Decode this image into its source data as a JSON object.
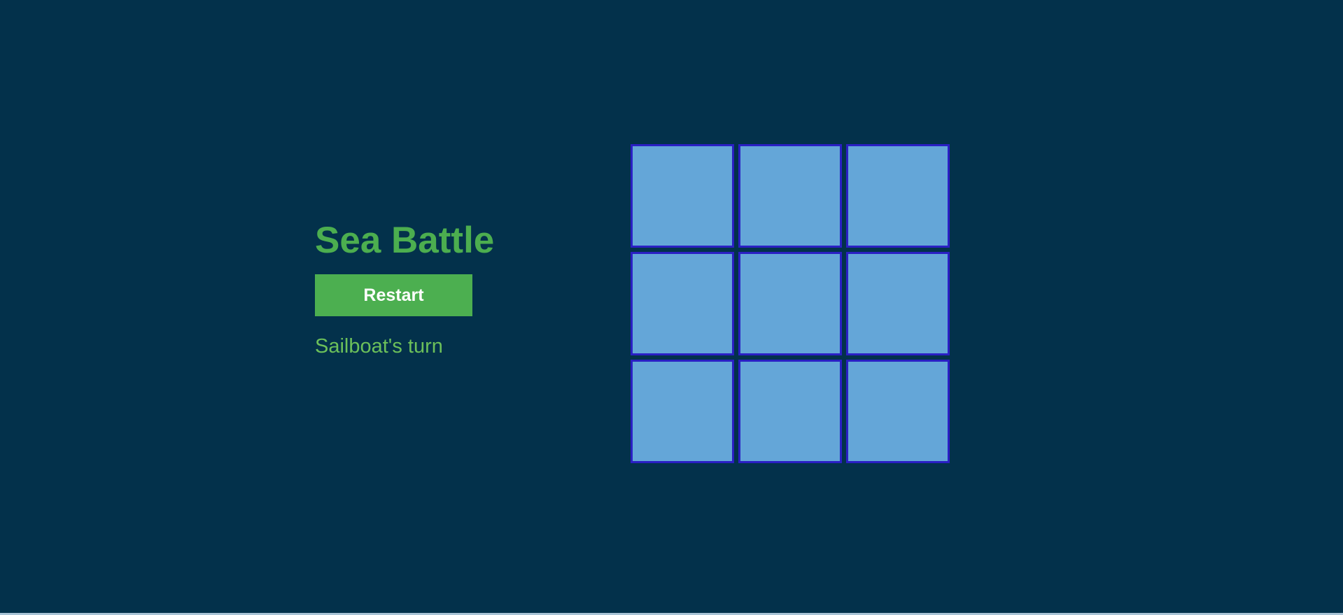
{
  "game": {
    "title": "Sea Battle",
    "restart_label": "Restart",
    "status": "Sailboat's turn"
  },
  "board": {
    "rows": 3,
    "cols": 3,
    "cells": [
      "",
      "",
      "",
      "",
      "",
      "",
      "",
      "",
      ""
    ]
  },
  "colors": {
    "background": "#03314b",
    "accent": "#4caf50",
    "cell_fill": "#64a6d8",
    "cell_border": "#2a1fc4"
  }
}
